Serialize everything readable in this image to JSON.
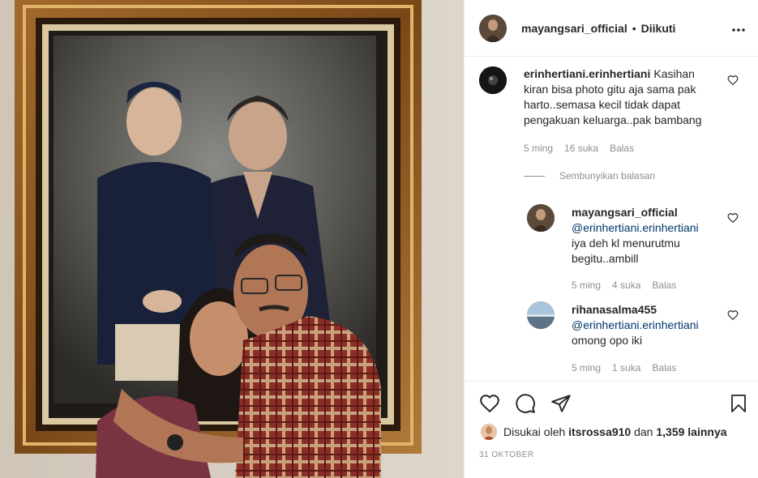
{
  "post": {
    "author": "mayangsari_official",
    "follow_state": "Diikuti",
    "separator": "•",
    "more_icon": "more-horizontal-icon"
  },
  "comments": [
    {
      "user": "erinhertiani.erinhertiani",
      "text": "Kasihan kiran bisa photo gitu aja sama pak harto..semasa kecil tidak dapat pengakuan keluarga..pak bambang",
      "line1": "Kasihan",
      "line2": "kiran bisa photo gitu aja sama pak",
      "line3": "harto..semasa kecil tidak dapat",
      "line4": "pengakuan keluarga..pak bambang",
      "time": "5 ming",
      "likes": "16 suka",
      "reply": "Balas"
    }
  ],
  "hide_replies_label": "Sembunyikan balasan",
  "replies": [
    {
      "user": "mayangsari_official",
      "mention": "@erinhertiani.erinhertiani",
      "line1": "iya deh kl menurutmu",
      "line2": "begitu..ambill",
      "time": "5 ming",
      "likes": "4 suka",
      "reply": "Balas"
    },
    {
      "user": "rihanasalma455",
      "mention": "@erinhertiani.erinhertiani",
      "line1": "omong opo iki",
      "time": "5 ming",
      "likes": "1 suka",
      "reply": "Balas"
    }
  ],
  "actions": {
    "like_icon": "heart-icon",
    "comment_icon": "comment-icon",
    "share_icon": "share-icon",
    "save_icon": "bookmark-icon"
  },
  "liked_by": {
    "prefix": "Disukai oleh",
    "user": "itsrossa910",
    "conj": "dan",
    "others": "1,359 lainnya"
  },
  "date": "31 OKTOBER",
  "colors": {
    "text": "#262626",
    "muted": "#8e8e8e",
    "mention": "#00376b",
    "border": "#efefef"
  }
}
